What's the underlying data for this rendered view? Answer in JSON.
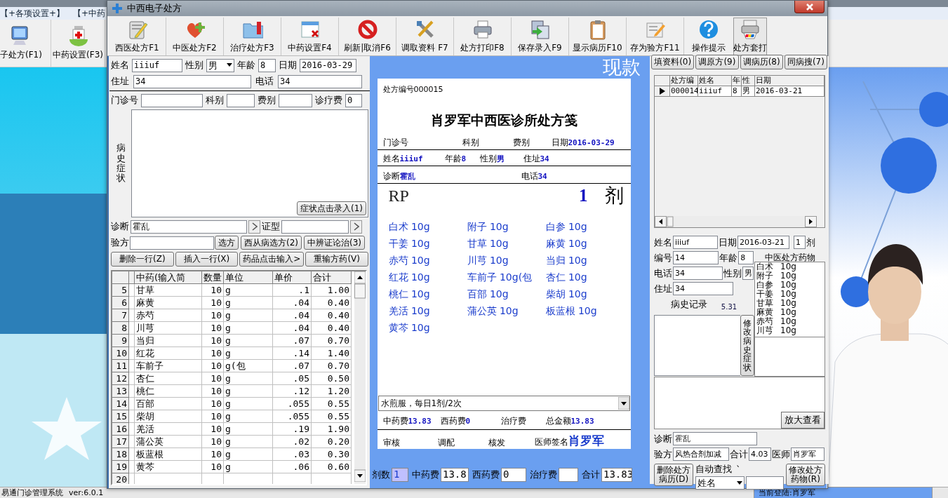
{
  "desktop": {
    "menu": [
      "【+各项设置+】",
      "【+中药"
    ],
    "toolbar": [
      {
        "label": "子处方(F1)"
      },
      {
        "label": "中药设置(F3)"
      }
    ],
    "status_bar": [
      "易通门诊管理系统",
      "ver:6.0.1",
      "当前登陆:肖罗军"
    ]
  },
  "window": {
    "title": "中西电子处方"
  },
  "toolbar": [
    {
      "label": "西医处方F1"
    },
    {
      "label": "中医处方F2"
    },
    {
      "label": "治疗处方F3"
    },
    {
      "label": "中药设置F4"
    },
    {
      "label": "刷新|取消F6"
    },
    {
      "label": "调取资料 F7"
    },
    {
      "label": "处方打印F8"
    },
    {
      "label": "保存录入F9"
    },
    {
      "label": "显示病历F10"
    },
    {
      "label": "存为验方F11"
    },
    {
      "label": "操作提示"
    },
    {
      "label": "处方套打"
    }
  ],
  "patient": {
    "name": {
      "label": "姓名",
      "value": "iiiuf"
    },
    "sex": {
      "label": "性别",
      "value": "男"
    },
    "age": {
      "label": "年龄",
      "value": "8"
    },
    "date": {
      "label": "日期",
      "value": "2016-03-29"
    },
    "address": {
      "label": "住址",
      "value": "34"
    },
    "phone": {
      "label": "电话",
      "value": "34"
    },
    "clinic_no": {
      "label": "门诊号"
    },
    "department": {
      "label": "科别"
    },
    "fee_type": {
      "label": "费别"
    },
    "consult_fee": {
      "label": "诊疗费",
      "value": "0"
    },
    "history_label": "病史症状",
    "symptom_button": "症状点击录入(1)",
    "diagnosis": {
      "label": "诊断",
      "value": "霍乱"
    },
    "syndrome": {
      "label": "证型"
    },
    "recipe": {
      "label": "验方"
    },
    "recipe_buttons": [
      "选方",
      "西从病选方(2)",
      "中辨证论治(3)"
    ],
    "row_buttons": [
      "删除一行(Z)",
      "插入一行(X)",
      "药品点击输入>",
      "重输方药(V)"
    ]
  },
  "herb_table": {
    "columns": [
      "中药(输入简",
      "数量",
      "单位",
      "单价",
      "合计"
    ],
    "rows": [
      {
        "no": "5",
        "name": "甘草",
        "qty": "10",
        "unit": "g",
        "price": ".1",
        "total": "1.00"
      },
      {
        "no": "6",
        "name": "麻黄",
        "qty": "10",
        "unit": "g",
        "price": ".04",
        "total": "0.40"
      },
      {
        "no": "7",
        "name": "赤芍",
        "qty": "10",
        "unit": "g",
        "price": ".04",
        "total": "0.40"
      },
      {
        "no": "8",
        "name": "川芎",
        "qty": "10",
        "unit": "g",
        "price": ".04",
        "total": "0.40"
      },
      {
        "no": "9",
        "name": "当归",
        "qty": "10",
        "unit": "g",
        "price": ".07",
        "total": "0.70"
      },
      {
        "no": "10",
        "name": "红花",
        "qty": "10",
        "unit": "g",
        "price": ".14",
        "total": "1.40"
      },
      {
        "no": "11",
        "name": "车前子",
        "qty": "10",
        "unit": "g(包",
        "price": ".07",
        "total": "0.70"
      },
      {
        "no": "12",
        "name": "杏仁",
        "qty": "10",
        "unit": "g",
        "price": ".05",
        "total": "0.50"
      },
      {
        "no": "13",
        "name": "桃仁",
        "qty": "10",
        "unit": "g",
        "price": ".12",
        "total": "1.20"
      },
      {
        "no": "14",
        "name": "百部",
        "qty": "10",
        "unit": "g",
        "price": ".055",
        "total": "0.55"
      },
      {
        "no": "15",
        "name": "柴胡",
        "qty": "10",
        "unit": "g",
        "price": ".055",
        "total": "0.55"
      },
      {
        "no": "16",
        "name": "羌活",
        "qty": "10",
        "unit": "g",
        "price": ".19",
        "total": "1.90"
      },
      {
        "no": "17",
        "name": "蒲公英",
        "qty": "10",
        "unit": "g",
        "price": ".02",
        "total": "0.20"
      },
      {
        "no": "18",
        "name": "板蓝根",
        "qty": "10",
        "unit": "g",
        "price": ".03",
        "total": "0.30"
      },
      {
        "no": "19",
        "name": "黄芩",
        "qty": "10",
        "unit": "g",
        "price": ".06",
        "total": "0.60"
      },
      {
        "no": "20"
      }
    ]
  },
  "prescription": {
    "payment": "现款",
    "number": "处方编号000015",
    "title": "肖罗军中西医诊所处方笺",
    "header": [
      {
        "label": "门诊号"
      },
      {
        "label": "科别"
      },
      {
        "label": "费别"
      },
      {
        "label": "日期",
        "value": "2016-03-29"
      }
    ],
    "patient_line": [
      {
        "label": "姓名",
        "value": "iiiuf"
      },
      {
        "label": "年龄",
        "value": "8"
      },
      {
        "label": "性别",
        "value": "男"
      },
      {
        "label": "住址",
        "value": "34"
      }
    ],
    "diagnosis_line": [
      {
        "label": "诊断",
        "value": "霍乱"
      },
      {
        "label": "电话",
        "value": "34"
      }
    ],
    "rp": "RP",
    "doses": "1",
    "dose_unit": "剂",
    "herbs": [
      "白术 10g",
      "附子 10g",
      "白参 10g",
      "干姜 10g",
      "甘草 10g",
      "麻黄 10g",
      "赤芍 10g",
      "川芎 10g",
      "当归 10g",
      "红花 10g",
      "车前子 10g(包",
      "杏仁 10g",
      "桃仁 10g",
      "百部 10g",
      "柴胡 10g",
      "羌活 10g",
      "蒲公英 10g",
      "板蓝根 10g",
      "黄芩 10g"
    ],
    "usage": "水煎服，每日1剂/2次",
    "fees": [
      {
        "label": "中药费",
        "value": "13.83"
      },
      {
        "label": "西药费",
        "value": "0"
      },
      {
        "label": "治疗费"
      },
      {
        "label": "总金额",
        "value": "13.83"
      }
    ],
    "signatures": [
      {
        "label": "审核"
      },
      {
        "label": "调配"
      },
      {
        "label": "核发"
      },
      {
        "label": "医师签名",
        "value": "肖罗军"
      }
    ]
  },
  "totals": [
    {
      "label": "剂数",
      "value": "1",
      "selected": true
    },
    {
      "label": "中药费",
      "value": "13.8",
      "selected": false
    },
    {
      "label": "西药费",
      "value": "0",
      "selected": false
    },
    {
      "label": "治疗费",
      "selected": false
    },
    {
      "label": "合计",
      "value": "13.83",
      "selected": false
    }
  ],
  "history": {
    "tabs": [
      "填资料(0)",
      "调原方(9)",
      "调病历(8)",
      "同病搜(7)"
    ],
    "columns": [
      "处方编",
      "姓名",
      "年",
      "性",
      "日期"
    ],
    "rows": [
      {
        "selected": true,
        "cells": [
          "000014",
          "iiiuf",
          "8",
          "男",
          "2016-03-21"
        ]
      }
    ]
  },
  "record": {
    "name": {
      "label": "姓名",
      "value": "iiiuf"
    },
    "date": {
      "label": "日期",
      "value": "2016-03-21"
    },
    "doses": "1",
    "dose_unit": "剂",
    "number": {
      "label": "编号",
      "value": "14"
    },
    "age": {
      "label": "年龄",
      "value": "8"
    },
    "phone": {
      "label": "电话",
      "value": "34"
    },
    "sex": {
      "label": "性别",
      "value": "男"
    },
    "address": {
      "label": "住址",
      "value": "34"
    },
    "herbs_title": "中医处方药物",
    "herbs": [
      {
        "name": "白术",
        "amount": "10g"
      },
      {
        "name": "附子",
        "amount": "10g"
      },
      {
        "name": "白参",
        "amount": "10g"
      },
      {
        "name": "干姜",
        "amount": "10g"
      },
      {
        "name": "甘草",
        "amount": "10g"
      },
      {
        "name": "麻黄",
        "amount": "10g"
      },
      {
        "name": "赤芍",
        "amount": "10g"
      },
      {
        "name": "川芎",
        "amount": "10g"
      }
    ],
    "history_label": "病史记录",
    "history_value": "5.31",
    "edit_history_button": "修改病史症状",
    "zoom_button": "放大查看",
    "diagnosis": {
      "label": "诊断",
      "value": "霍乱"
    },
    "recipe": {
      "label": "验方",
      "value": "风热合剂加减"
    },
    "total": {
      "label": "合计",
      "value": "4.03"
    },
    "doctor": {
      "label": "医师",
      "value": "肖罗军"
    },
    "delete_button": "删除处方病历(D)",
    "search_label": "自动查找",
    "search_mark": "`",
    "search_field": "姓名",
    "modify_button": "修改处方药物(R)"
  }
}
